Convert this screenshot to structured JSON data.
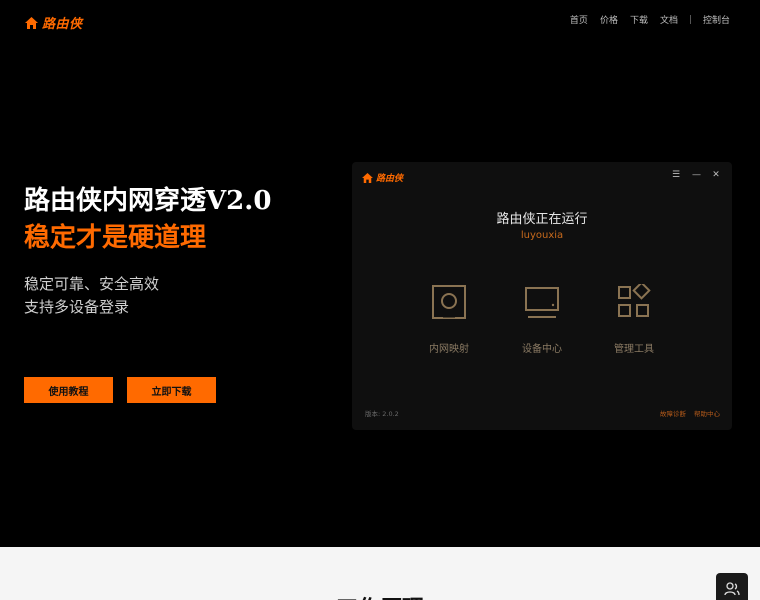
{
  "header": {
    "logo_text": "路由侠",
    "nav": [
      "首页",
      "价格",
      "下载",
      "文档"
    ],
    "console_link": "控制台"
  },
  "hero": {
    "title": "路由侠内网穿透V2.0",
    "subtitle": "稳定才是硬道理",
    "desc_line1": "稳定可靠、安全高效",
    "desc_line2": "支持多设备登录",
    "btn_tutorial": "使用教程",
    "btn_download": "立即下载"
  },
  "app": {
    "logo_text": "路由侠",
    "status": "路由侠正在运行",
    "username": "luyouxia",
    "features": [
      "内网映射",
      "设备中心",
      "管理工具"
    ],
    "version": "版本: 2.0.2",
    "link_diagnose": "故障诊断",
    "link_help": "帮助中心"
  },
  "bottom": {
    "title": "工作原理"
  },
  "colors": {
    "accent": "#ff6a00",
    "background": "#000000",
    "panel": "#0f0f0f"
  }
}
